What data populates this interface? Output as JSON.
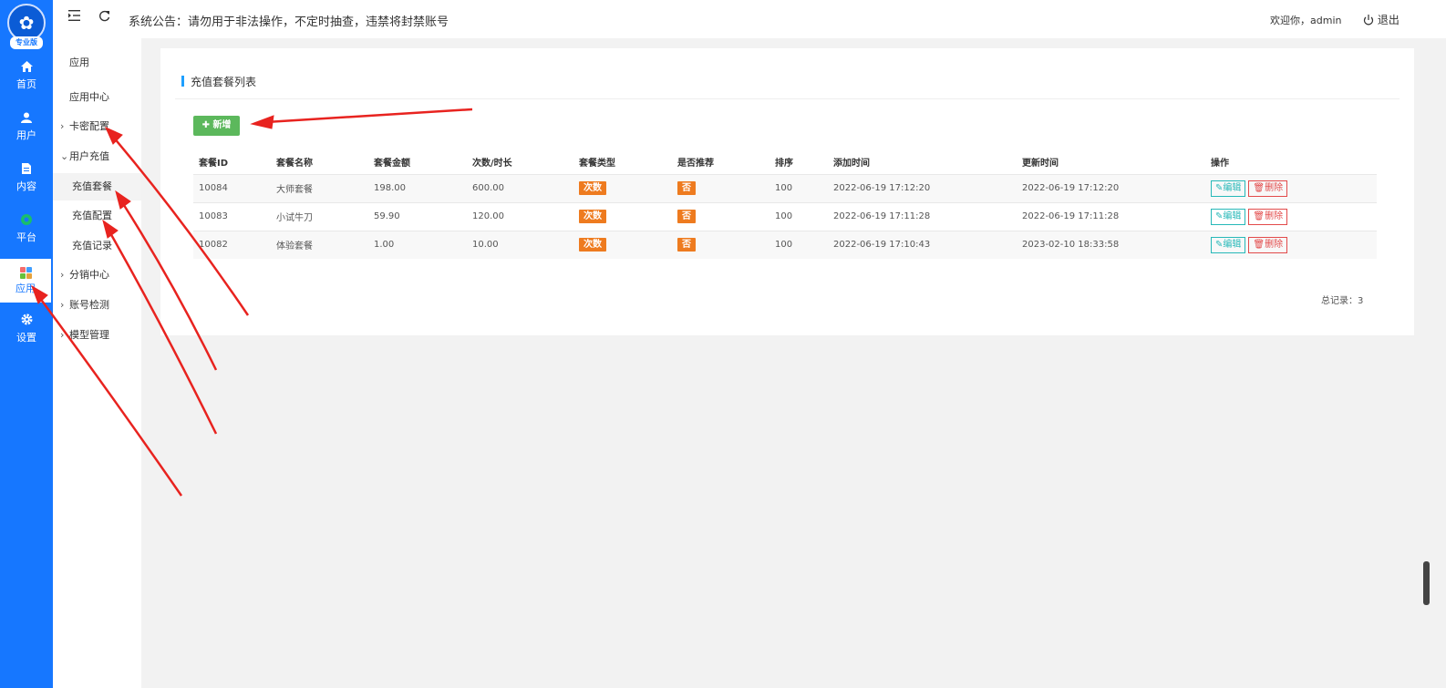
{
  "rail": {
    "logo_badge": "专业版",
    "items": [
      {
        "label": "首页",
        "icon": "home-icon"
      },
      {
        "label": "用户",
        "icon": "user-icon"
      },
      {
        "label": "内容",
        "icon": "document-icon"
      },
      {
        "label": "平台",
        "icon": "platform-icon"
      },
      {
        "label": "应用",
        "icon": "apps-grid-icon"
      },
      {
        "label": "设置",
        "icon": "gear-icon"
      }
    ]
  },
  "topbar": {
    "notice": "系统公告：请勿用于非法操作，不定时抽查，违禁将封禁账号",
    "welcome": "欢迎你，admin",
    "logout_label": "退出"
  },
  "submenu": {
    "title": "应用",
    "items": [
      {
        "label": "应用中心"
      },
      {
        "label": "卡密配置"
      },
      {
        "label": "用户充值"
      },
      {
        "label": "充值套餐"
      },
      {
        "label": "充值配置"
      },
      {
        "label": "充值记录"
      },
      {
        "label": "分销中心"
      },
      {
        "label": "账号检测"
      },
      {
        "label": "模型管理"
      }
    ]
  },
  "panel": {
    "title": "充值套餐列表",
    "add_label": "新增",
    "columns": [
      "套餐ID",
      "套餐名称",
      "套餐金额",
      "次数/时长",
      "套餐类型",
      "是否推荐",
      "排序",
      "添加时间",
      "更新时间",
      "操作"
    ],
    "rows": [
      {
        "id": "10084",
        "name": "大师套餐",
        "amount": "198.00",
        "count": "600.00",
        "type": "次数",
        "recommend": "否",
        "sort": "100",
        "created": "2022-06-19 17:12:20",
        "updated": "2022-06-19 17:12:20"
      },
      {
        "id": "10083",
        "name": "小试牛刀",
        "amount": "59.90",
        "count": "120.00",
        "type": "次数",
        "recommend": "否",
        "sort": "100",
        "created": "2022-06-19 17:11:28",
        "updated": "2022-06-19 17:11:28"
      },
      {
        "id": "10082",
        "name": "体验套餐",
        "amount": "1.00",
        "count": "10.00",
        "type": "次数",
        "recommend": "否",
        "sort": "100",
        "created": "2022-06-19 17:10:43",
        "updated": "2023-02-10 18:33:58"
      }
    ],
    "edit_label": "编辑",
    "delete_label": "删除",
    "total_label": "总记录：",
    "total_value": "3"
  },
  "colors": {
    "rail_blue": "#1677ff",
    "add_green": "#5cb85c",
    "tag_orange": "#ee7b1f",
    "edit_teal": "#26b8b8",
    "delete_red": "#e24a4a",
    "annotation_red": "#e8231f"
  }
}
